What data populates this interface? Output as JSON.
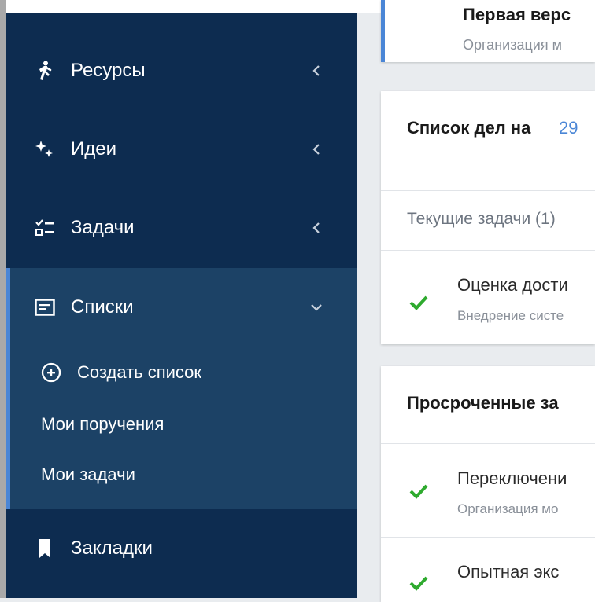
{
  "sidebar": {
    "items": [
      {
        "label": "Ресурсы",
        "icon": "person-walking-icon"
      },
      {
        "label": "Идеи",
        "icon": "sparkles-icon"
      },
      {
        "label": "Задачи",
        "icon": "checklist-icon"
      },
      {
        "label": "Списки",
        "icon": "list-box-icon"
      },
      {
        "label": "Закладки",
        "icon": "bookmark-icon"
      }
    ],
    "lists_submenu": {
      "create_label": "Создать список",
      "items": [
        "Мои поручения",
        "Мои задачи"
      ]
    }
  },
  "content": {
    "top_card": {
      "title": "Первая верс",
      "subtitle": "Организация м"
    },
    "todo_card": {
      "title": "Список дел на",
      "date": "29",
      "section_label": "Текущие задачи (1)",
      "tasks": [
        {
          "title": "Оценка дости",
          "subtitle": "Внедрение систе"
        }
      ]
    },
    "overdue_card": {
      "title": "Просроченные за",
      "tasks": [
        {
          "title": "Переключени",
          "subtitle": "Организация мо"
        },
        {
          "title": "Опытная экс",
          "subtitle": ""
        }
      ]
    }
  },
  "colors": {
    "sidebar_bg": "#0d2c50",
    "sidebar_active_bg": "#1c4266",
    "accent_blue": "#4a86d6",
    "check_green": "#2eaa2e"
  }
}
